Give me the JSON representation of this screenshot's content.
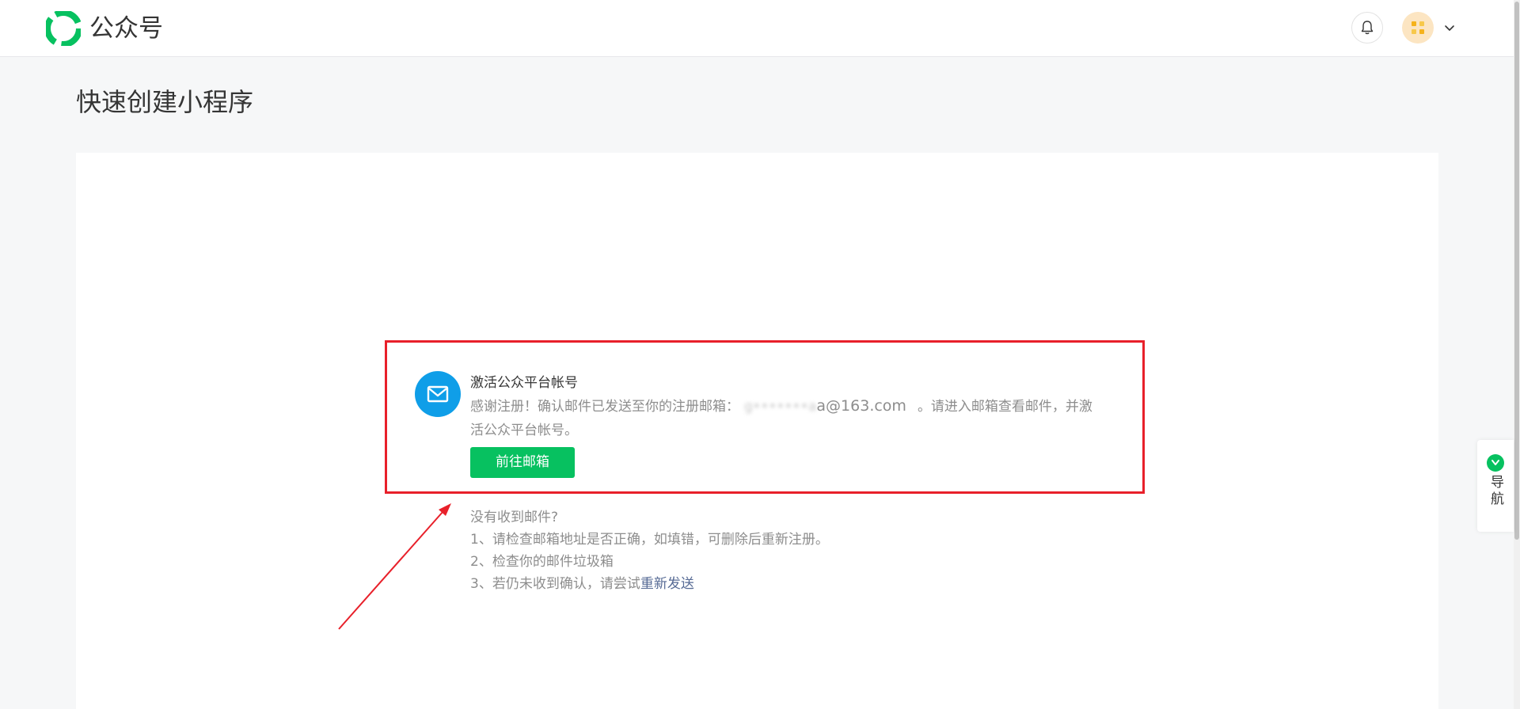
{
  "header": {
    "brand": "公众号"
  },
  "page": {
    "title": "快速创建小程序"
  },
  "activation": {
    "title": "激活公众平台帐号",
    "body_prefix": "感谢注册！确认邮件已发送至你的注册邮箱：",
    "email_masked_part": "g•••••••a",
    "email_visible_part": "a@163.com",
    "body_suffix": "。请进入邮箱查看邮件，并激活公众平台帐号。",
    "button_label": "前往邮箱"
  },
  "help": {
    "heading": "没有收到邮件?",
    "item1": "1、请检查邮箱地址是否正确，如填错，可删除后重新注册。",
    "item2": "2、检查你的邮件垃圾箱",
    "item3_prefix": "3、若仍未收到确认，请尝试",
    "item3_link": "重新发送"
  },
  "side_nav": {
    "label": "导航"
  },
  "icons": {
    "logo": "wechat-official-account-logo",
    "bell": "bell-icon",
    "avatar": "avatar-icon",
    "chevron": "chevron-down-icon",
    "mail": "mail-icon",
    "nav": "nav-icon"
  },
  "colors": {
    "brand_green": "#07c160",
    "mail_blue": "#0f9ee8",
    "annotation_red": "#e8202a",
    "link_blue": "#576b95"
  }
}
